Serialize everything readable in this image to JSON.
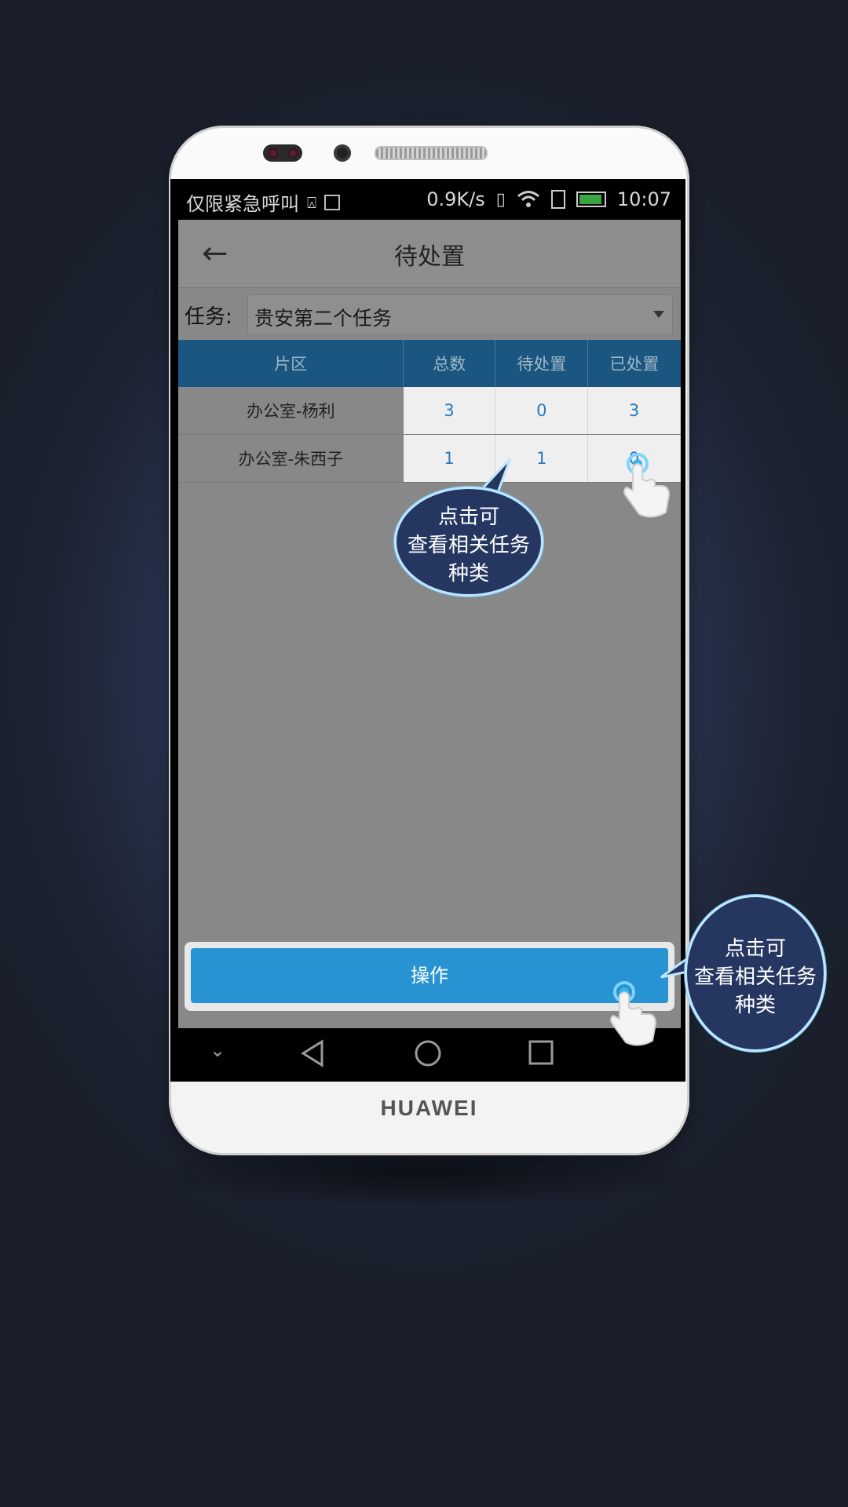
{
  "status_bar": {
    "carrier": "仅限紧急呼叫",
    "speed": "0.9K/s",
    "time": "10:07"
  },
  "header": {
    "title": "待处置"
  },
  "task": {
    "label": "任务:",
    "selected": "贵安第二个任务"
  },
  "table": {
    "columns": [
      "片区",
      "总数",
      "待处置",
      "已处置"
    ],
    "rows": [
      {
        "area": "办公室-杨利",
        "total": "3",
        "pending": "0",
        "done": "3"
      },
      {
        "area": "办公室-朱西子",
        "total": "1",
        "pending": "1",
        "done": "0"
      }
    ]
  },
  "action_button": {
    "label": "操作"
  },
  "phone": {
    "brand": "HUAWEI"
  },
  "callouts": [
    {
      "line1": "点击可",
      "line2": "查看相关任务",
      "line3": "种类"
    },
    {
      "line1": "点击可",
      "line2": "查看相关任务",
      "line3": "种类"
    }
  ],
  "colors": {
    "table_header": "#1a5680",
    "button": "#2893d3",
    "link_number": "#2d7ab8",
    "bubble": "#253761"
  }
}
